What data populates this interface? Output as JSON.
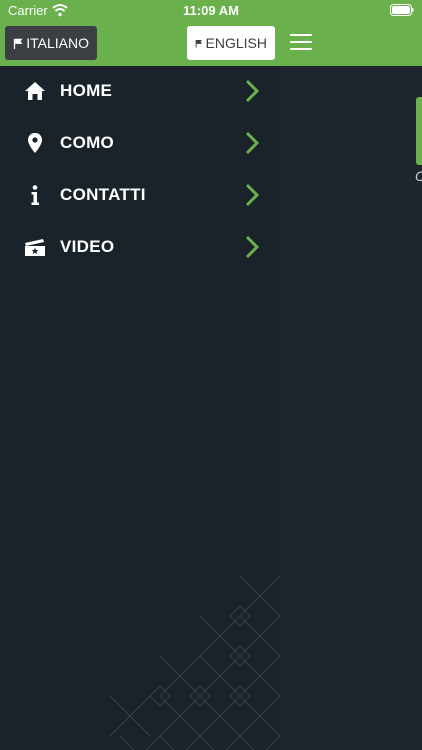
{
  "status_bar": {
    "carrier": "Carrier",
    "time": "11:09 AM"
  },
  "header": {
    "lang_italiano": "ITALIANO",
    "lang_english": "ENGLISH"
  },
  "menu": {
    "items": [
      {
        "label": "HOME",
        "icon": "home-icon"
      },
      {
        "label": "COMO",
        "icon": "location-pin-icon"
      },
      {
        "label": "CONTATTI",
        "icon": "info-icon"
      },
      {
        "label": "VIDEO",
        "icon": "video-ticket-icon"
      }
    ]
  },
  "content": {
    "peek_text": "C"
  },
  "colors": {
    "accent": "#6ab04c",
    "drawer_bg": "#1a222a",
    "content_bg": "#1e262e"
  }
}
